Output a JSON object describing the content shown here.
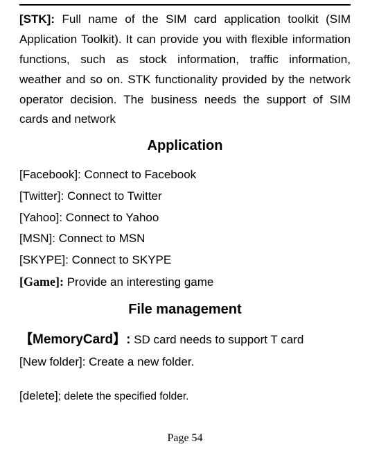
{
  "stk": {
    "label": "[STK]:",
    "text": " Full name of the SIM card application toolkit (SIM Application Toolkit). It can provide you with flexible information functions, such as stock information, traffic information, weather and so on. STK functionality provided by the network operator decision. The business needs the support of SIM cards and network"
  },
  "heading_application": "Application",
  "apps": {
    "facebook": "[Facebook]: Connect to Facebook",
    "twitter": "[Twitter]: Connect to Twitter",
    "yahoo": "[Yahoo]: Connect to Yahoo",
    "msn": "[MSN]: Connect to MSN",
    "skype": "[SKYPE]: Connect to SKYPE",
    "game_label": "[Game]:",
    "game_text": " Provide an interesting game"
  },
  "heading_file": "File management",
  "file": {
    "memcard_label": "【MemoryCard】:",
    "memcard_text": " SD card needs to support T card",
    "newfolder": "[New folder]: Create a new folder.",
    "delete_label": "[delete]",
    "delete_text": "; delete the specified folder."
  },
  "page_number": "Page 54"
}
